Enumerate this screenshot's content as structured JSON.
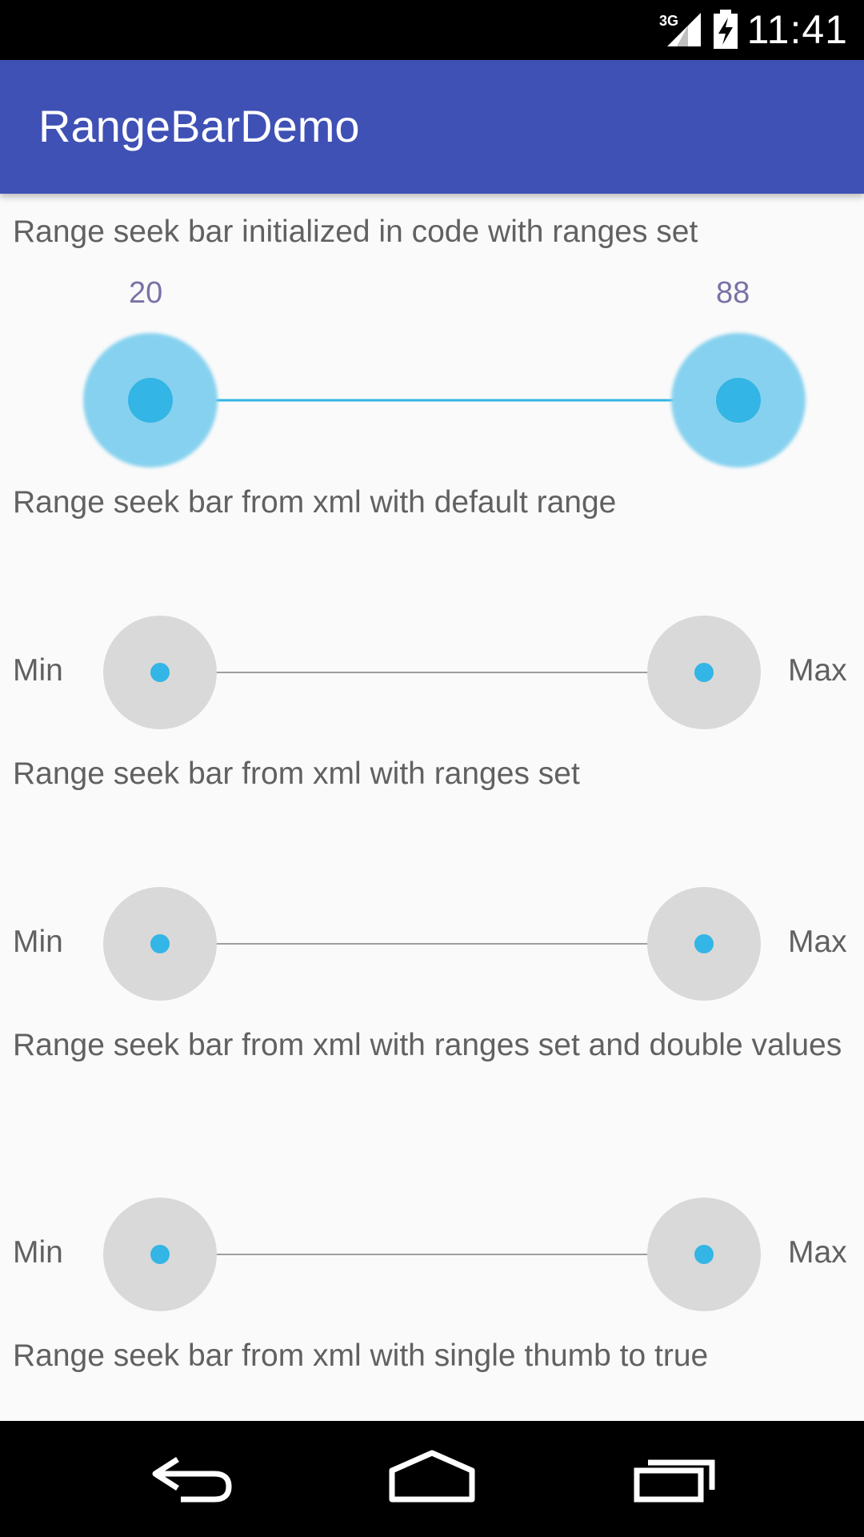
{
  "status_bar": {
    "time": "11:41",
    "network": "3G",
    "icons": [
      "signal-icon",
      "battery-charging-icon"
    ]
  },
  "app_bar": {
    "title": "RangeBarDemo",
    "color": "#3f51b5"
  },
  "sections": [
    {
      "label": "Range seek bar initialized in code with ranges set",
      "min_value": "20",
      "max_value": "88"
    },
    {
      "label": "Range seek bar from xml with default range",
      "min_label": "Min",
      "max_label": "Max"
    },
    {
      "label": "Range seek bar from xml with ranges set",
      "min_label": "Min",
      "max_label": "Max"
    },
    {
      "label": "Range seek bar from xml with ranges set and double values",
      "min_label": "Min",
      "max_label": "Max"
    },
    {
      "label": "Range seek bar from xml with single thumb to true"
    }
  ],
  "colors": {
    "accent": "#33b5e5",
    "thumb_halo_active": "#86d1ef",
    "thumb_halo_idle": "#d9d9d9",
    "track": "#9e9e9e"
  },
  "nav_bar": {
    "icons": [
      "back-icon",
      "home-icon",
      "recents-icon"
    ]
  }
}
